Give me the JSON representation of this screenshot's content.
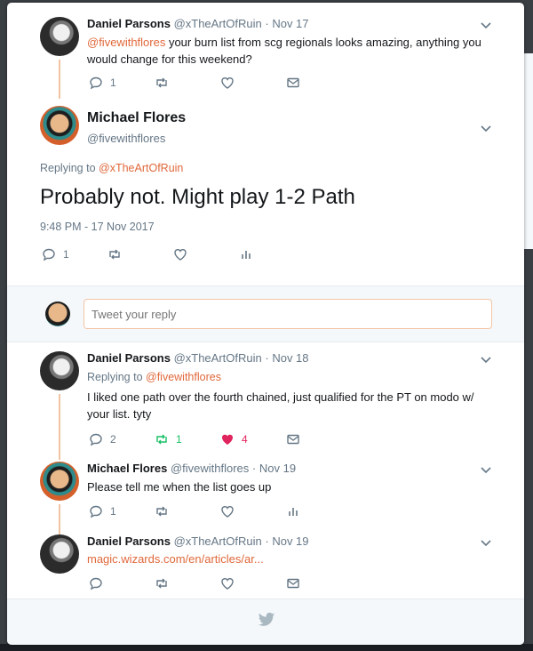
{
  "tweets": {
    "t1": {
      "name": "Daniel Parsons",
      "handle": "@xTheArtOfRuin",
      "dot": "·",
      "date": "Nov 17",
      "mention": "@fivewithflores",
      "text": " your burn list from scg regionals looks amazing, anything you would change for this weekend?",
      "reply_count": "1"
    },
    "main": {
      "name": "Michael Flores",
      "handle": "@fivewithflores",
      "replying_label": "Replying to ",
      "replying_to": "@xTheArtOfRuin",
      "text": "Probably not. Might play 1-2 Path",
      "timestamp": "9:48 PM - 17 Nov 2017",
      "reply_count": "1"
    },
    "t3": {
      "name": "Daniel Parsons",
      "handle": "@xTheArtOfRuin",
      "dot": "·",
      "date": "Nov 18",
      "replying_label": "Replying to ",
      "replying_to": "@fivewithflores",
      "text": "I liked one path over the fourth chained, just qualified for the PT on modo w/ your list. tyty",
      "reply_count": "2",
      "retweet_count": "1",
      "like_count": "4"
    },
    "t4": {
      "name": "Michael Flores",
      "handle": "@fivewithflores",
      "dot": "·",
      "date": "Nov 19",
      "text": "Please tell me when the list goes up",
      "reply_count": "1"
    },
    "t5": {
      "name": "Daniel Parsons",
      "handle": "@xTheArtOfRuin",
      "dot": "·",
      "date": "Nov 19",
      "link": "magic.wizards.com/en/articles/ar..."
    }
  },
  "reply_box": {
    "placeholder": "Tweet your reply"
  },
  "icons": {
    "reply": "reply-icon",
    "retweet": "retweet-icon",
    "like": "heart-icon",
    "dm": "envelope-icon",
    "analytics": "bar-chart-icon",
    "more": "chevron-down-icon",
    "footer": "twitter-bird-icon"
  },
  "colors": {
    "accent": "#e0683b",
    "retweet_active": "#17bf63",
    "like_active": "#e0245e",
    "thread_line": "#f2c3a3"
  }
}
